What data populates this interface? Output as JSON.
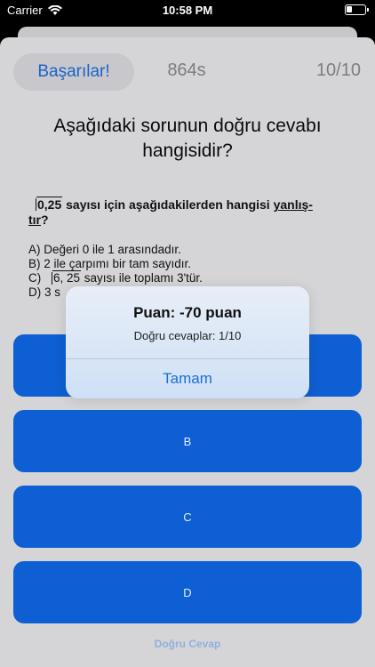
{
  "status_bar": {
    "carrier": "Carrier",
    "time": "10:58 PM"
  },
  "header": {
    "achievements_label": "Başarılar!",
    "timer": "864s",
    "progress": "10/10"
  },
  "title": "Aşağıdaki sorunun doğru cevabı hangisidir?",
  "question": {
    "sqrt_value": "0,25",
    "line1_text": " sayısı için aşağıdakilerden hangisi ",
    "line1_underlined": "yanlış-",
    "line2_underlined": "tır",
    "line2_text": "?",
    "option_a": "A) Değeri 0 ile 1 arasındadır.",
    "option_b": "B) 2 ile çarpımı bir tam sayıdır.",
    "option_c_prefix": "C) ",
    "option_c_sqrt": "6, 25",
    "option_c_text": " sayısı ile toplamı 3'tür.",
    "option_d": "D) 3 s"
  },
  "answers": {
    "a": "",
    "b": "B",
    "c": "C",
    "d": "D"
  },
  "correct_answer_label": "Doğru Cevap",
  "alert": {
    "title": "Puan: -70 puan",
    "message": "Doğru cevaplar: 1/10",
    "button": "Tamam"
  },
  "colors": {
    "accent_blue": "#0e5fd3",
    "link_blue": "#1d6fd6"
  }
}
